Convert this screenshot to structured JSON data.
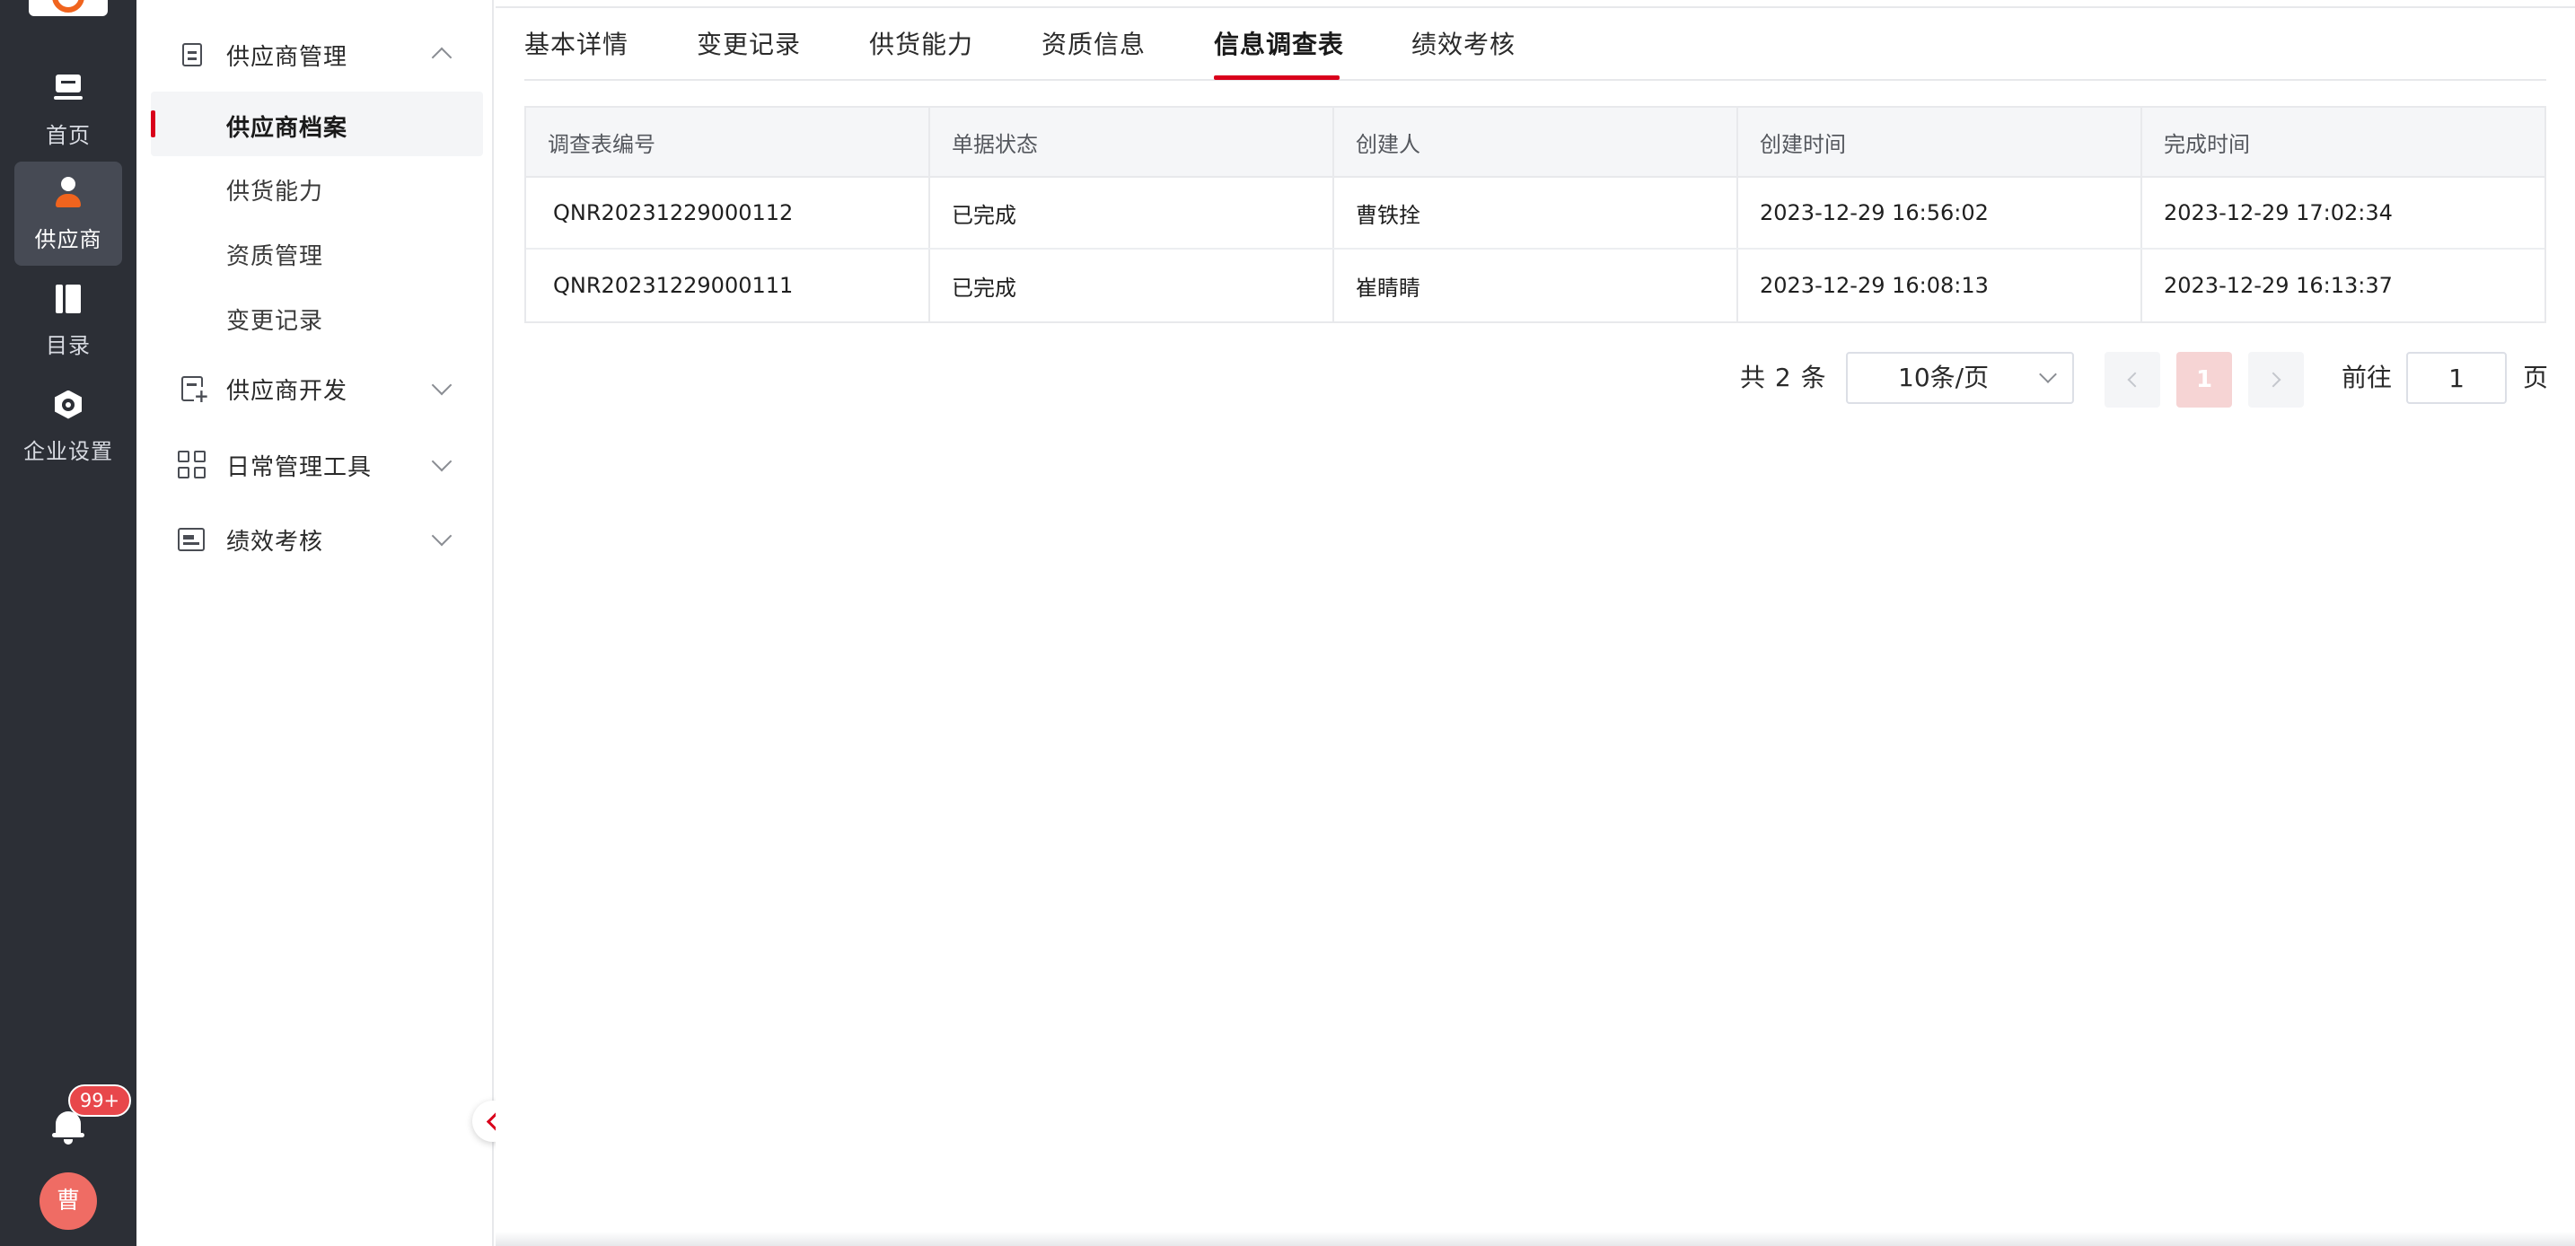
{
  "rail": {
    "items": [
      {
        "label": "首页",
        "icon": "home-icon"
      },
      {
        "label": "供应商",
        "icon": "supplier-icon",
        "active": true
      },
      {
        "label": "目录",
        "icon": "catalog-icon"
      },
      {
        "label": "企业设置",
        "icon": "enterprise-settings-icon"
      }
    ],
    "notification_badge": "99+",
    "avatar_text": "曹"
  },
  "sidebar": {
    "groups": [
      {
        "label": "供应商管理",
        "icon": "document-icon",
        "expanded": true
      },
      {
        "label": "供应商开发",
        "icon": "add-document-icon",
        "expanded": false
      },
      {
        "label": "日常管理工具",
        "icon": "grid-icon",
        "expanded": false
      },
      {
        "label": "绩效考核",
        "icon": "card-icon",
        "expanded": false
      }
    ],
    "sub_items": [
      {
        "label": "供应商档案",
        "active": true
      },
      {
        "label": "供货能力"
      },
      {
        "label": "资质管理"
      },
      {
        "label": "变更记录"
      }
    ]
  },
  "tabs": [
    {
      "label": "基本详情"
    },
    {
      "label": "变更记录"
    },
    {
      "label": "供货能力"
    },
    {
      "label": "资质信息"
    },
    {
      "label": "信息调查表",
      "active": true
    },
    {
      "label": "绩效考核"
    }
  ],
  "table": {
    "columns": [
      "调查表编号",
      "单据状态",
      "创建人",
      "创建时间",
      "完成时间"
    ],
    "rows": [
      [
        "QNR20231229000112",
        "已完成",
        "曹铁拴",
        "2023-12-29 16:56:02",
        "2023-12-29 17:02:34"
      ],
      [
        "QNR20231229000111",
        "已完成",
        "崔睛睛",
        "2023-12-29 16:08:13",
        "2023-12-29 16:13:37"
      ]
    ]
  },
  "pagination": {
    "total_text": "共 2 条",
    "page_size": "10条/页",
    "current_page": "1",
    "goto_label": "前往",
    "goto_value": "1",
    "page_suffix": "页"
  },
  "colors": {
    "accent": "#d9001b",
    "link": "#2f7fd6",
    "rail_bg": "#2c2f36",
    "brand_orange": "#f0641e"
  }
}
